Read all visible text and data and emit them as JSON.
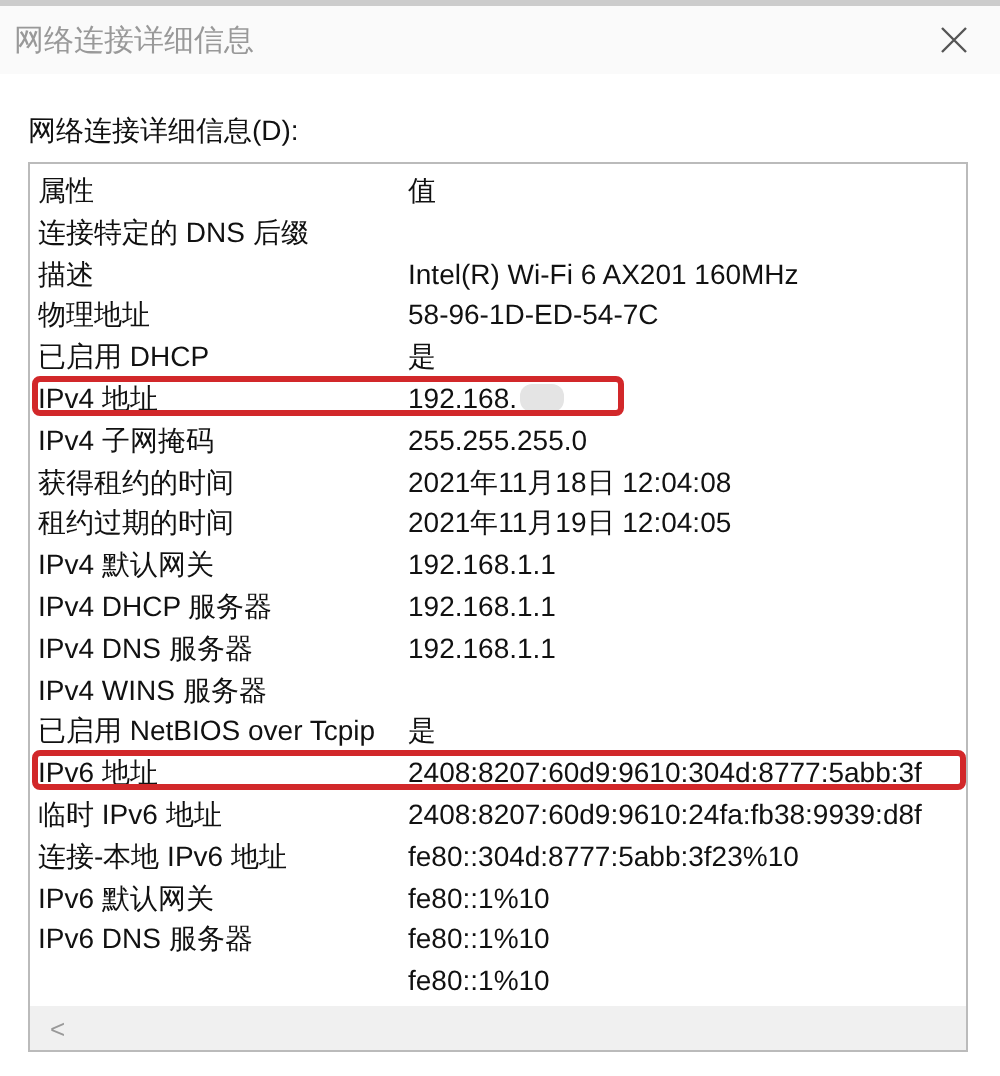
{
  "window": {
    "title": "网络连接详细信息"
  },
  "list_label": "网络连接详细信息(D):",
  "table": {
    "columns": [
      "属性",
      "值"
    ],
    "rows": [
      {
        "property": "连接特定的 DNS 后缀",
        "value": ""
      },
      {
        "property": "描述",
        "value": "Intel(R) Wi-Fi 6 AX201 160MHz"
      },
      {
        "property": "物理地址",
        "value": "58-96-1D-ED-54-7C"
      },
      {
        "property": "已启用 DHCP",
        "value": "是"
      },
      {
        "property": "IPv4 地址",
        "value": "192.168.",
        "redacted": true,
        "highlighted": true
      },
      {
        "property": "IPv4 子网掩码",
        "value": "255.255.255.0"
      },
      {
        "property": "获得租约的时间",
        "value": "2021年11月18日 12:04:08"
      },
      {
        "property": "租约过期的时间",
        "value": "2021年11月19日 12:04:05"
      },
      {
        "property": "IPv4 默认网关",
        "value": "192.168.1.1"
      },
      {
        "property": "IPv4 DHCP 服务器",
        "value": "192.168.1.1"
      },
      {
        "property": "IPv4 DNS 服务器",
        "value": "192.168.1.1"
      },
      {
        "property": "IPv4 WINS 服务器",
        "value": ""
      },
      {
        "property": "已启用 NetBIOS over Tcpip",
        "value": "是"
      },
      {
        "property": "IPv6 地址",
        "value": "2408:8207:60d9:9610:304d:8777:5abb:3f",
        "highlighted": true
      },
      {
        "property": "临时 IPv6 地址",
        "value": "2408:8207:60d9:9610:24fa:fb38:9939:d8f"
      },
      {
        "property": "连接-本地 IPv6 地址",
        "value": "fe80::304d:8777:5abb:3f23%10"
      },
      {
        "property": "IPv6 默认网关",
        "value": "fe80::1%10"
      },
      {
        "property": "IPv6 DNS 服务器",
        "value": "fe80::1%10"
      },
      {
        "property": "",
        "value": "fe80::1%10"
      }
    ]
  },
  "scrollbar": {
    "arrow": "<"
  }
}
